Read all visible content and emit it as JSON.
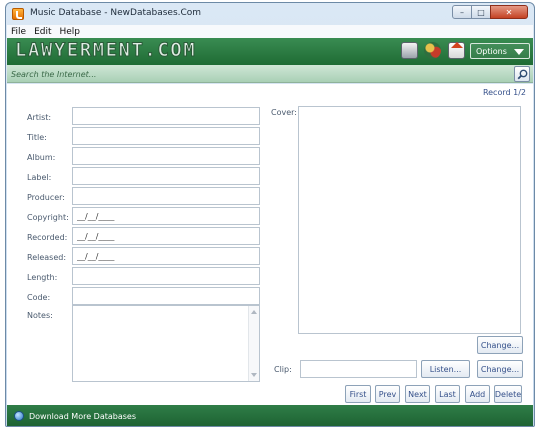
{
  "window": {
    "title": "Music Database - NewDatabases.Com"
  },
  "menu": {
    "items": [
      "File",
      "Edit",
      "Help"
    ]
  },
  "banner": {
    "watermark": "LAWYERMENT.COM",
    "options_label": "Options"
  },
  "search": {
    "placeholder": "Search the Internet..."
  },
  "record": {
    "label": "Record 1/2"
  },
  "form": {
    "fields": [
      {
        "label": "Artist:",
        "value": ""
      },
      {
        "label": "Title:",
        "value": ""
      },
      {
        "label": "Album:",
        "value": ""
      },
      {
        "label": "Label:",
        "value": ""
      },
      {
        "label": "Producer:",
        "value": ""
      },
      {
        "label": "Copyright:",
        "value": "__/__/____"
      },
      {
        "label": "Recorded:",
        "value": "__/__/____"
      },
      {
        "label": "Released:",
        "value": "__/__/____"
      },
      {
        "label": "Length:",
        "value": ""
      },
      {
        "label": "Code:",
        "value": ""
      }
    ],
    "notes_label": "Notes:",
    "cover_label": "Cover:",
    "clip_label": "Clip:"
  },
  "buttons": {
    "change_cover": "Change...",
    "listen": "Listen...",
    "change_clip": "Change...",
    "nav": [
      "First",
      "Prev",
      "Next",
      "Last",
      "Add",
      "Delete"
    ]
  },
  "status": {
    "link": "Download More Databases"
  },
  "colors": {
    "banner_green": "#2a7a43",
    "status_green": "#26703c",
    "accent_blue": "#35508a"
  }
}
